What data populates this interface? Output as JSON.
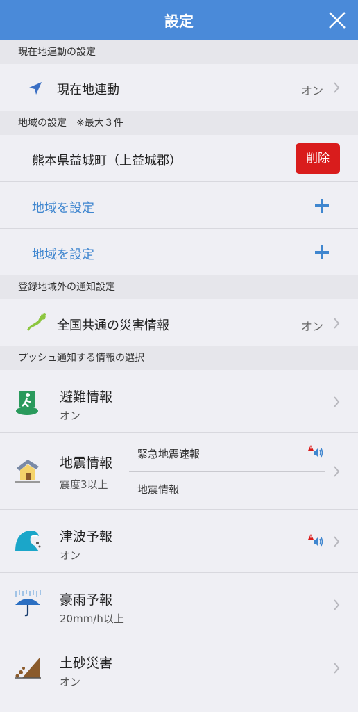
{
  "header": {
    "title": "設定"
  },
  "sections": {
    "location": "現在地連動の設定",
    "regions": "地域の設定　※最大３件",
    "outside": "登録地域外の通知設定",
    "push": "プッシュ通知する情報の選択"
  },
  "location_link": {
    "label": "現在地連動",
    "value": "オン"
  },
  "regions": {
    "name": "熊本県益城町（上益城郡）",
    "delete_label": "削除",
    "add_label_1": "地域を設定",
    "add_label_2": "地域を設定"
  },
  "nationwide": {
    "label": "全国共通の災害情報",
    "value": "オン"
  },
  "push_items": {
    "evacuation": {
      "title": "避難情報",
      "sub": "オン"
    },
    "earthquake": {
      "title": "地震情報",
      "sub": "震度3以上",
      "sub_item_1": "緊急地震速報",
      "sub_item_2": "地震情報"
    },
    "tsunami": {
      "title": "津波予報",
      "sub": "オン"
    },
    "rain": {
      "title": "豪雨予報",
      "sub": "20mm/h以上"
    },
    "landslide": {
      "title": "土砂災害",
      "sub": "オン"
    }
  },
  "colors": {
    "header": "#4a8ad9",
    "delete": "#d91c1c",
    "link": "#3f86cf",
    "background": "#efeff4"
  },
  "icons": [
    "close-icon",
    "location-arrow-icon",
    "japan-map-icon",
    "plus-icon",
    "chevron-right-icon",
    "evacuation-icon",
    "earthquake-house-icon",
    "tsunami-wave-icon",
    "rain-umbrella-icon",
    "landslide-icon",
    "alert-sound-icon"
  ]
}
